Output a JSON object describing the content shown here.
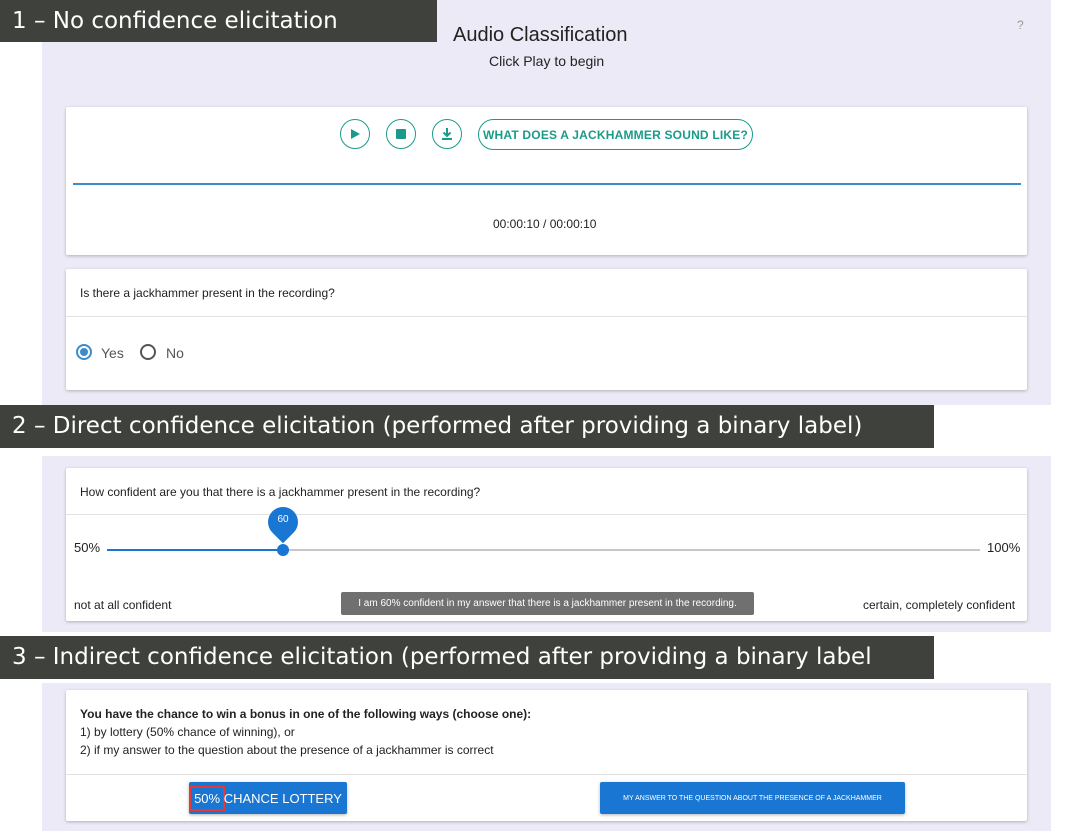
{
  "section1": {
    "banner": "1 – No confidence elicitation",
    "title": "Audio Classification",
    "subtitle": "Click Play to begin",
    "help": "?",
    "player": {
      "example_button": "WHAT DOES A JACKHAMMER SOUND LIKE?",
      "time": "00:00:10 / 00:00:10",
      "progress": 1.0
    },
    "question": "Is there a jackhammer present in the recording?",
    "options": [
      "Yes",
      "No"
    ],
    "selected": "Yes"
  },
  "section2": {
    "banner": "2 – Direct confidence elicitation (performed after providing a binary label)",
    "question": "How confident are you that there is a jackhammer present in the recording?",
    "slider": {
      "min_label": "50%",
      "max_label": "100%",
      "value": 60,
      "value_label": "60",
      "min": 50,
      "max": 100
    },
    "left_caption": "not at all confident",
    "right_caption": "certain, completely confident",
    "tooltip": "I am 60% confident in my answer that there is a jackhammer present in the recording."
  },
  "section3": {
    "banner": "3 – Indirect confidence elicitation (performed after providing a binary label",
    "instruction": "You have the chance to win a bonus in one of the following ways (choose one):",
    "option1": "1) by lottery (50% chance of winning), or",
    "option2": "2) if my answer to the question about the presence of a jackhammer is correct",
    "lottery_pct": "50%",
    "lottery_rest": " CHANCE LOTTERY",
    "answer_button": "MY ANSWER TO THE QUESTION ABOUT THE PRESENCE OF A JACKHAMMER"
  },
  "colors": {
    "teal": "#1a9b8a",
    "blue": "#1976d2",
    "panel": "#eceaf6",
    "banner": "#3e413c",
    "highlight": "#e53935"
  }
}
